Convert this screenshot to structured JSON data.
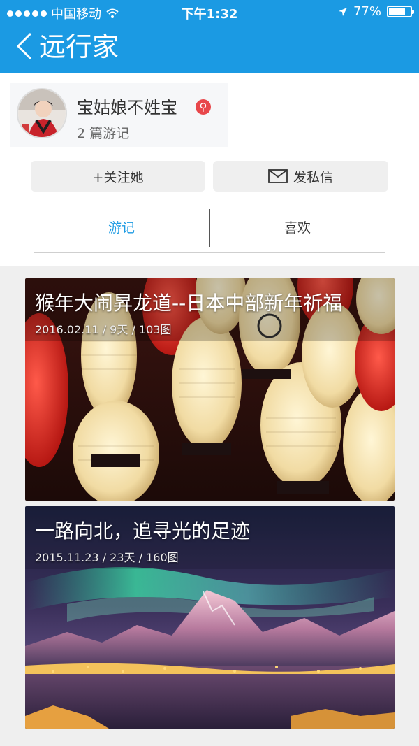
{
  "status_bar": {
    "carrier": "中国移动",
    "time": "下午1:32",
    "battery_text": "77%",
    "battery_level": 0.77
  },
  "nav": {
    "title": "远行家",
    "back_icon": "chevron-left-icon"
  },
  "profile": {
    "name": "宝姑娘不姓宝",
    "gender_symbol": "♀",
    "gender_color": "#e8474b",
    "trip_count": "2 篇游记"
  },
  "actions": {
    "follow_label": "+关注她",
    "message_label": "发私信",
    "message_icon": "envelope-icon"
  },
  "tabs": [
    {
      "label": "游记",
      "active": true
    },
    {
      "label": "喜欢",
      "active": false
    }
  ],
  "trips": [
    {
      "title": "猴年大闹昇龙道--日本中部新年祈福",
      "meta": "2016.02.11 / 9天 / 103图"
    },
    {
      "title": "一路向北，追寻光的足迹",
      "meta": "2015.11.23 / 23天 / 160图"
    }
  ],
  "colors": {
    "accent": "#1b9ae3",
    "background": "#efefef"
  }
}
